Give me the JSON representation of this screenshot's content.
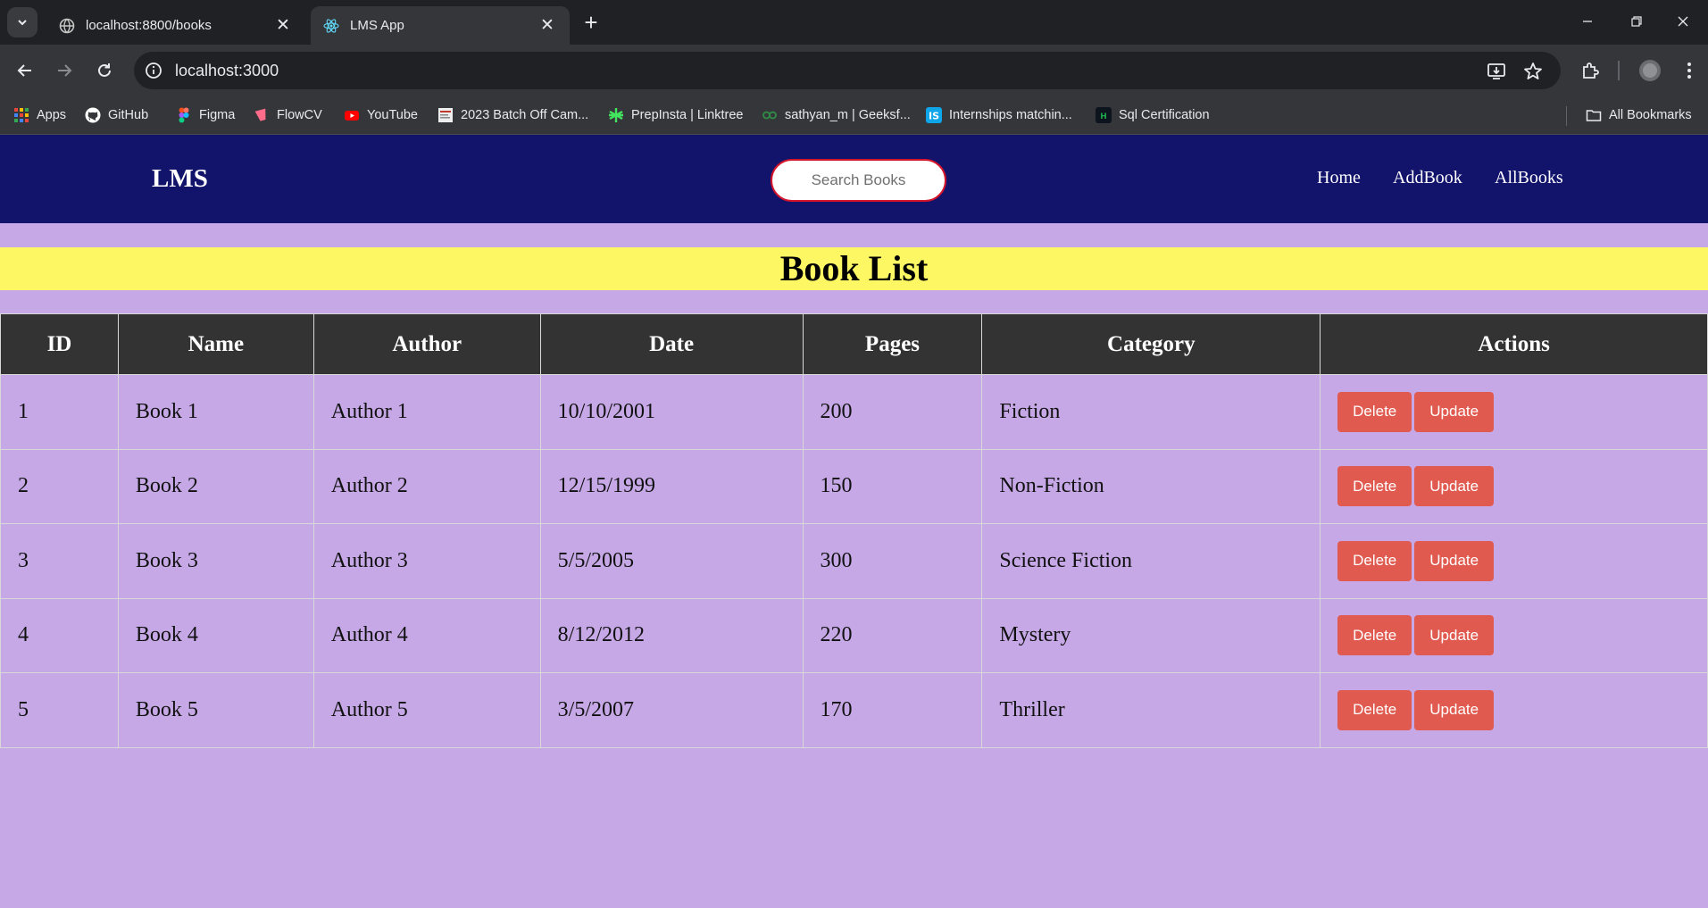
{
  "browser": {
    "tabs": [
      {
        "title": "localhost:8800/books",
        "active": false
      },
      {
        "title": "LMS App",
        "active": true
      }
    ],
    "url": "localhost:3000",
    "bookmarks": [
      {
        "label": "Apps",
        "icon": "apps-grid-icon",
        "color": "#e8453c"
      },
      {
        "label": "GitHub",
        "icon": "github-icon",
        "color": "#ffffff"
      },
      {
        "label": "Figma",
        "icon": "figma-icon",
        "color": "#f24e1e"
      },
      {
        "label": "FlowCV",
        "icon": "flowcv-icon",
        "color": "#ff6b8a"
      },
      {
        "label": "YouTube",
        "icon": "youtube-icon",
        "color": "#ff0000"
      },
      {
        "label": "2023 Batch Off Cam...",
        "icon": "page-thumbnail-icon",
        "color": "#cccccc"
      },
      {
        "label": "PrepInsta | Linktree",
        "icon": "linktree-icon",
        "color": "#43e55e"
      },
      {
        "label": "sathyan_m | Geeksf...",
        "icon": "geeksforgeeks-icon",
        "color": "#2f8d46"
      },
      {
        "label": "Internships matchin...",
        "icon": "internshala-icon",
        "color": "#0ea5e9"
      },
      {
        "label": "Sql Certification",
        "icon": "hackerrank-icon",
        "color": "#1ba94c"
      }
    ],
    "all_bookmarks": "All Bookmarks"
  },
  "app": {
    "logo": "LMS",
    "search_placeholder": "Search Books",
    "nav": [
      "Home",
      "AddBook",
      "AllBooks"
    ],
    "heading": "Book List",
    "columns": [
      "ID",
      "Name",
      "Author",
      "Date",
      "Pages",
      "Category",
      "Actions"
    ],
    "rows": [
      {
        "id": "1",
        "name": "Book 1",
        "author": "Author 1",
        "date": "10/10/2001",
        "pages": "200",
        "category": "Fiction"
      },
      {
        "id": "2",
        "name": "Book 2",
        "author": "Author 2",
        "date": "12/15/1999",
        "pages": "150",
        "category": "Non-Fiction"
      },
      {
        "id": "3",
        "name": "Book 3",
        "author": "Author 3",
        "date": "5/5/2005",
        "pages": "300",
        "category": "Science Fiction"
      },
      {
        "id": "4",
        "name": "Book 4",
        "author": "Author 4",
        "date": "8/12/2012",
        "pages": "220",
        "category": "Mystery"
      },
      {
        "id": "5",
        "name": "Book 5",
        "author": "Author 5",
        "date": "3/5/2007",
        "pages": "170",
        "category": "Thriller"
      }
    ],
    "delete_label": "Delete",
    "update_label": "Update",
    "colors": {
      "nav_bg": "#12136b",
      "page_bg": "#c5a8e5",
      "banner_bg": "#fdf764",
      "header_bg": "#333333",
      "button_bg": "#e05a4f"
    }
  }
}
